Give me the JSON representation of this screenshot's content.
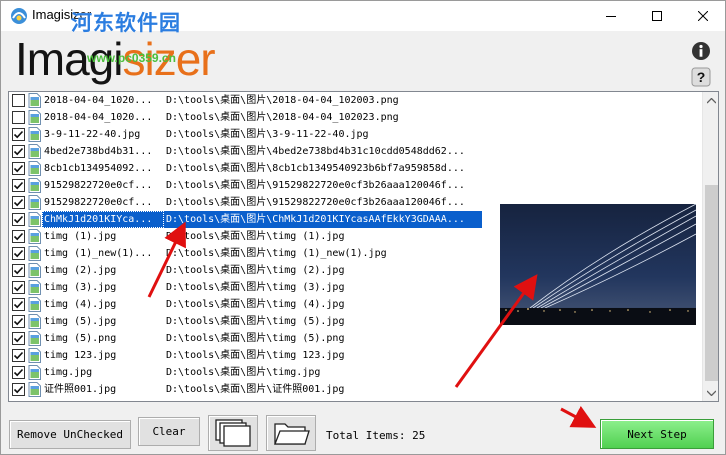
{
  "window": {
    "title": "Imagisizer",
    "watermark_text": "河东软件园",
    "watermark_url": "www.pc0359.cn"
  },
  "logo": {
    "part1": "Imagi",
    "part2": "sizer"
  },
  "files": [
    {
      "checked": false,
      "name": "2018-04-04_1020...",
      "path": "D:\\tools\\桌面\\图片\\2018-04-04_102003.png",
      "selected": false
    },
    {
      "checked": false,
      "name": "2018-04-04_1020...",
      "path": "D:\\tools\\桌面\\图片\\2018-04-04_102023.png",
      "selected": false
    },
    {
      "checked": true,
      "name": "3-9-11-22-40.jpg",
      "path": "D:\\tools\\桌面\\图片\\3-9-11-22-40.jpg",
      "selected": false
    },
    {
      "checked": true,
      "name": "4bed2e738bd4b31...",
      "path": "D:\\tools\\桌面\\图片\\4bed2e738bd4b31c10cdd0548dd62...",
      "selected": false
    },
    {
      "checked": true,
      "name": "8cb1cb134954092...",
      "path": "D:\\tools\\桌面\\图片\\8cb1cb1349540923b6bf7a959858d...",
      "selected": false
    },
    {
      "checked": true,
      "name": "91529822720e0cf...",
      "path": "D:\\tools\\桌面\\图片\\91529822720e0cf3b26aaa120046f...",
      "selected": false
    },
    {
      "checked": true,
      "name": "91529822720e0cf...",
      "path": "D:\\tools\\桌面\\图片\\91529822720e0cf3b26aaa120046f...",
      "selected": false
    },
    {
      "checked": true,
      "name": "ChMkJ1d201KIYca...",
      "path": "D:\\tools\\桌面\\图片\\ChMkJ1d201KIYcasAAfEkkY3GDAAA...",
      "selected": true
    },
    {
      "checked": true,
      "name": "timg (1).jpg",
      "path": "D:\\tools\\桌面\\图片\\timg (1).jpg",
      "selected": false
    },
    {
      "checked": true,
      "name": "timg (1)_new(1)...",
      "path": "D:\\tools\\桌面\\图片\\timg (1)_new(1).jpg",
      "selected": false
    },
    {
      "checked": true,
      "name": "timg (2).jpg",
      "path": "D:\\tools\\桌面\\图片\\timg (2).jpg",
      "selected": false
    },
    {
      "checked": true,
      "name": "timg (3).jpg",
      "path": "D:\\tools\\桌面\\图片\\timg (3).jpg",
      "selected": false
    },
    {
      "checked": true,
      "name": "timg (4).jpg",
      "path": "D:\\tools\\桌面\\图片\\timg (4).jpg",
      "selected": false
    },
    {
      "checked": true,
      "name": "timg (5).jpg",
      "path": "D:\\tools\\桌面\\图片\\timg (5).jpg",
      "selected": false
    },
    {
      "checked": true,
      "name": "timg (5).png",
      "path": "D:\\tools\\桌面\\图片\\timg (5).png",
      "selected": false
    },
    {
      "checked": true,
      "name": "timg 123.jpg",
      "path": "D:\\tools\\桌面\\图片\\timg 123.jpg",
      "selected": false
    },
    {
      "checked": true,
      "name": "timg.jpg",
      "path": "D:\\tools\\桌面\\图片\\timg.jpg",
      "selected": false
    },
    {
      "checked": true,
      "name": "证件照001.jpg",
      "path": "D:\\tools\\桌面\\图片\\证件照001.jpg",
      "selected": false
    }
  ],
  "buttons": {
    "remove_unchecked": "Remove UnChecked",
    "clear": "Clear",
    "next_step": "Next Step"
  },
  "status": {
    "total_items": "Total Items: 25"
  },
  "colors": {
    "selection": "#0a5fcc",
    "logo_accent": "#e8701a",
    "next_button": "#5cdc5c",
    "annotation_arrow": "#e01010"
  },
  "icons": [
    "app-icon",
    "info-icon",
    "help-icon",
    "image-file-icon",
    "layers-icon",
    "folder-icon"
  ]
}
